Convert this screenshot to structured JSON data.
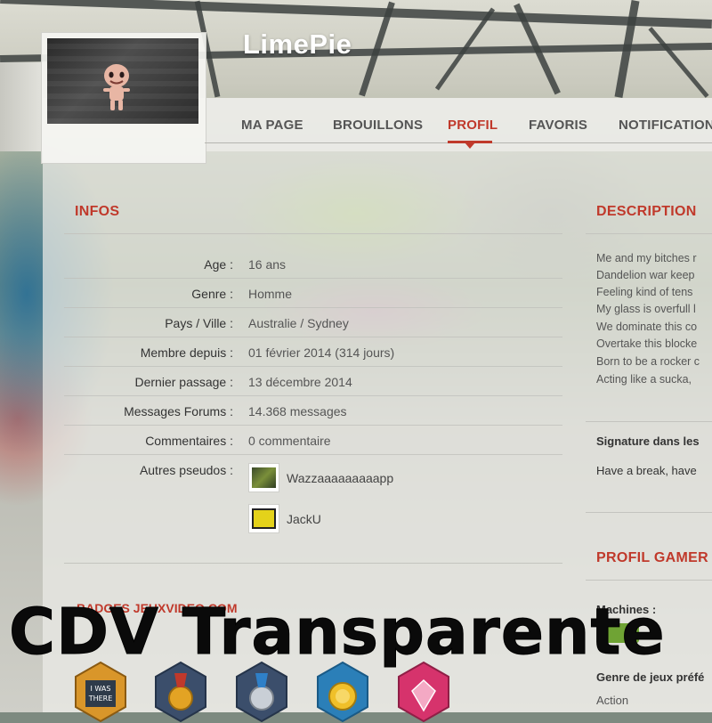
{
  "profile": {
    "username": "LimePie"
  },
  "nav": {
    "items": [
      {
        "label": "MA PAGE"
      },
      {
        "label": "BROUILLONS"
      },
      {
        "label": "PROFIL",
        "active": true
      },
      {
        "label": "FAVORIS"
      },
      {
        "label": "NOTIFICATIONS"
      }
    ]
  },
  "infos": {
    "title": "INFOS",
    "rows": [
      {
        "label": "Age :",
        "value": "16 ans"
      },
      {
        "label": "Genre :",
        "value": "Homme"
      },
      {
        "label": "Pays / Ville :",
        "value": "Australie / Sydney"
      },
      {
        "label": "Membre depuis :",
        "value": "01 février 2014 (314 jours)"
      },
      {
        "label": "Dernier passage :",
        "value": "13 décembre 2014"
      },
      {
        "label": "Messages Forums :",
        "value": "14.368 messages"
      },
      {
        "label": "Commentaires :",
        "value": "0 commentaire"
      }
    ],
    "pseudos_label": "Autres pseudos :",
    "pseudos": [
      {
        "name": "Wazzaaaaaaaaapp"
      },
      {
        "name": "JackU"
      }
    ],
    "badges_link": "BADGES JEUXVIDEO.COM"
  },
  "description": {
    "title": "DESCRIPTION",
    "lines": [
      "Me and my bitches r",
      "Dandelion war keep",
      "Feeling kind of tens",
      "My glass is overfull l",
      "We dominate this co",
      "Overtake this blocke",
      "Born to be a rocker c",
      "Acting like a sucka,"
    ],
    "signature_label": "Signature dans les",
    "signature_text": "Have a break, have"
  },
  "gamer": {
    "title": "PROFIL GAMER",
    "machines_label": "Machines :",
    "genre_label": "Genre de jeux préfé",
    "genre_value": "Action"
  },
  "badges": [
    {
      "name": "i-was-there-badge",
      "text_line1": "I WAS",
      "text_line2": "THERE"
    },
    {
      "name": "gold-medal-badge"
    },
    {
      "name": "silver-medal-badge"
    },
    {
      "name": "gold-coin-badge"
    },
    {
      "name": "gem-badge"
    }
  ],
  "overlay": {
    "caption": "CDV Transparente"
  },
  "colors": {
    "accent": "#c0392b",
    "page_bg": "#ececE8"
  }
}
